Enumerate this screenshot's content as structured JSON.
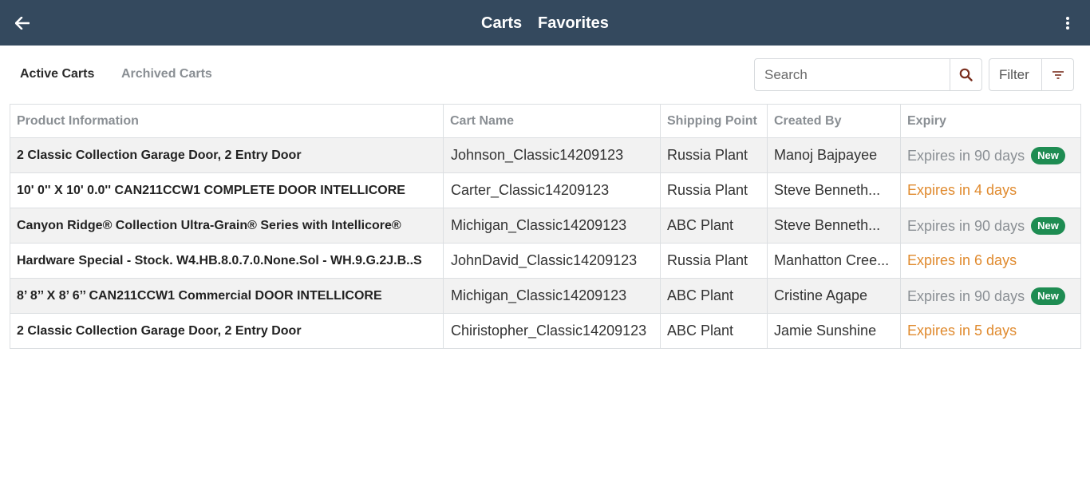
{
  "header": {
    "tabs": [
      "Carts",
      "Favorites"
    ],
    "back_icon": "arrow-left-icon",
    "menu_icon": "more-vertical-icon",
    "bg_color": "#34495e"
  },
  "subtabs": {
    "active": "Active Carts",
    "archived": "Archived Carts"
  },
  "search": {
    "placeholder": "Search",
    "value": "",
    "icon": "search-icon"
  },
  "filter": {
    "label": "Filter",
    "icon": "filter-icon"
  },
  "table": {
    "columns": [
      "Product Information",
      "Cart Name",
      "Shipping Point",
      "Created By",
      "Expiry"
    ],
    "rows": [
      {
        "product": "2 Classic Collection Garage Door, 2 Entry Door",
        "cart": "Johnson_Classic14209123",
        "ship": "Russia Plant",
        "created": "Manoj Bajpayee",
        "expiry": "Expires in 90 days",
        "badge": "New",
        "warn": false
      },
      {
        "product": "10' 0'' X 10' 0.0'' CAN211CCW1 COMPLETE DOOR INTELLICORE",
        "cart": "Carter_Classic14209123",
        "ship": "Russia Plant",
        "created": "Steve Benneth...",
        "expiry": "Expires in 4 days",
        "badge": "",
        "warn": true
      },
      {
        "product": "Canyon Ridge® Collection Ultra-Grain® Series with Intellicore®",
        "cart": "Michigan_Classic14209123",
        "ship": "ABC Plant",
        "created": "Steve Benneth...",
        "expiry": "Expires in 90 days",
        "badge": "New",
        "warn": false
      },
      {
        "product": "Hardware Special - Stock. W4.HB.8.0.7.0.None.Sol - WH.9.G.2J.B..S",
        "cart": "JohnDavid_Classic14209123",
        "ship": "Russia Plant",
        "created": "Manhatton Cree...",
        "expiry": "Expires in 6 days",
        "badge": "",
        "warn": true
      },
      {
        "product": "8’ 8’’ X 8’ 6’’ CAN211CCW1 Commercial DOOR INTELLICORE",
        "cart": "Michigan_Classic14209123",
        "ship": "ABC Plant",
        "created": "Cristine Agape",
        "expiry": "Expires in 90 days",
        "badge": "New",
        "warn": false
      },
      {
        "product": "2 Classic Collection Garage Door, 2 Entry Door",
        "cart": "Chiristopher_Classic14209123",
        "ship": "ABC Plant",
        "created": "Jamie Sunshine",
        "expiry": "Expires in 5 days",
        "badge": "",
        "warn": true
      }
    ]
  },
  "colors": {
    "badge_green": "#1e8c52",
    "expiry_warn": "#e08a2e",
    "muted": "#8a8f94"
  }
}
